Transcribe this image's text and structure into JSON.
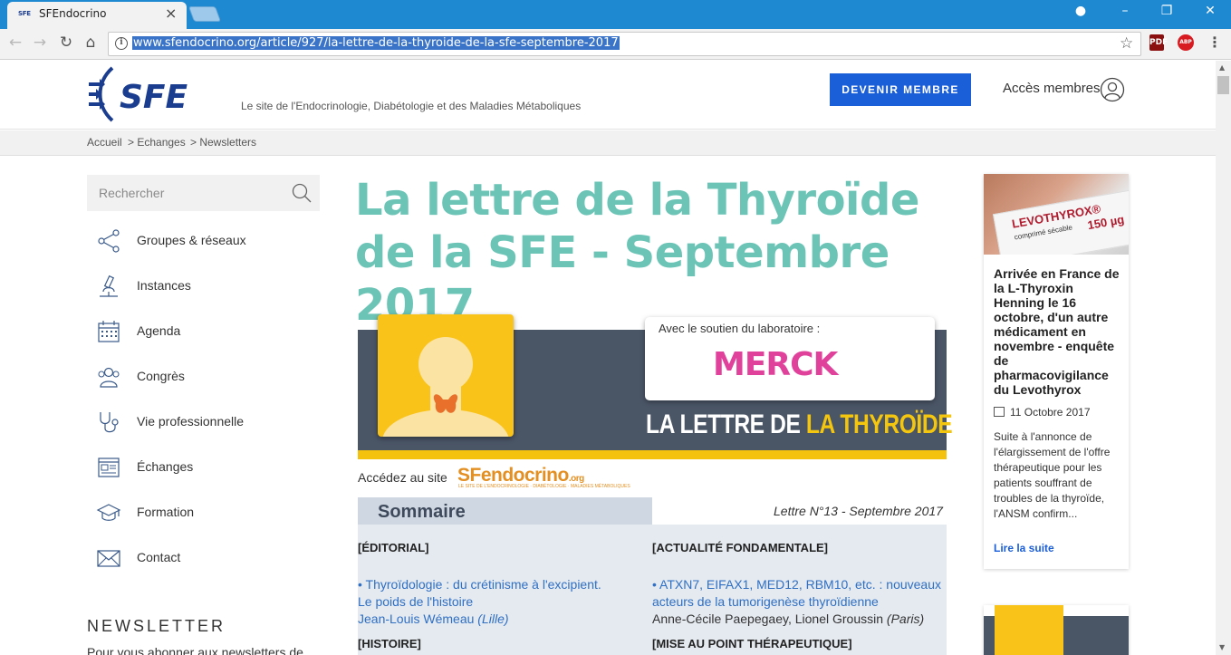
{
  "browser": {
    "tab_title": "SFEndocrino",
    "tab_favicon": "SFE",
    "url": "www.sfendocrino.org/article/927/la-lettre-de-la-thyroide-de-la-sfe-septembre-2017",
    "extensions": {
      "pdf": "PDF",
      "abp": "ABP"
    }
  },
  "header": {
    "logo": "SFE",
    "tagline": "Le site de l'Endocrinologie, Diabétologie et des Maladies Métaboliques",
    "cta_label": "DEVENIR MEMBRE",
    "members_label": "Accès membres"
  },
  "breadcrumb": [
    "Accueil",
    "> Echanges",
    "> Newsletters"
  ],
  "search": {
    "placeholder": "Rechercher"
  },
  "sidebar": {
    "items": [
      {
        "label": "Groupes & réseaux",
        "icon": "share-icon"
      },
      {
        "label": "Instances",
        "icon": "microscope-icon"
      },
      {
        "label": "Agenda",
        "icon": "calendar-icon"
      },
      {
        "label": "Congrès",
        "icon": "people-icon"
      },
      {
        "label": "Vie professionnelle",
        "icon": "stethoscope-icon"
      },
      {
        "label": "Échanges",
        "icon": "newspaper-icon"
      },
      {
        "label": "Formation",
        "icon": "graduation-cap-icon"
      },
      {
        "label": "Contact",
        "icon": "envelope-icon"
      }
    ],
    "newsletter_title": "NEWSLETTER",
    "newsletter_text": "Pour vous abonner aux newsletters de"
  },
  "article": {
    "title": "La lettre de la Thyroïde de la SFE - Septembre 2017",
    "banner": {
      "sponsor_text": "Avec le soutien du laboratoire :",
      "sponsor_logo": "MERCK",
      "caption_a": "LA LETTRE DE ",
      "caption_b": "LA THYROÏDE"
    },
    "access_text": "Accédez au site",
    "access_logo": "SFendocrino",
    "access_logo_suffix": ".org",
    "access_sub": "LE SITE DE L'ENDOCRINOLOGIE · DIABÉTOLOGIE · MALADIES MÉTABOLIQUES",
    "sommaire_title": "Sommaire",
    "letter_number": "Lettre N°13 - Septembre 2017",
    "sections": {
      "left_head": "[ÉDITORIAL]",
      "left_link_1": "• Thyroïdologie : du crétinisme à l'excipient.",
      "left_link_2": "Le poids de l'histoire",
      "left_author_name": "Jean-Louis Wémeau ",
      "left_author_city": "(Lille)",
      "left_head_2": "[HISTOIRE]",
      "right_head": "[ACTUALITÉ FONDAMENTALE]",
      "right_link_1": "• ATXN7, EIFAX1, MED12, RBM10, etc. : nouveaux",
      "right_link_2": "acteurs de la tumorigenèse thyroïdienne",
      "right_author_name": "Anne-Cécile Paepegaey,  Lionel Groussin ",
      "right_author_city": "(Paris)",
      "right_head_2": "[MISE AU POINT THÉRAPEUTIQUE]"
    }
  },
  "news_card": {
    "image_brand": "LEVOTHYROX®",
    "image_dose": "150 µg",
    "image_sub": "comprimé sécable",
    "title": "Arrivée en France de la L-Thyroxin Henning le 16 octobre, d'un autre médicament en novembre - enquête de pharmacovigilance du Levothyrox",
    "date": "11 Octobre 2017",
    "excerpt": "Suite à l'annonce de l'élargissement de l'offre thérapeutique pour les patients souffrant de troubles de la thyroïde, l'ANSM confirm...",
    "more_label": "Lire la suite"
  },
  "colors": {
    "title_teal": "#6bc4b6",
    "cta_blue": "#1a5ed8",
    "link_blue": "#2f6fc4",
    "merck_pink": "#e0419b",
    "banner_yellow": "#f4c20d"
  }
}
